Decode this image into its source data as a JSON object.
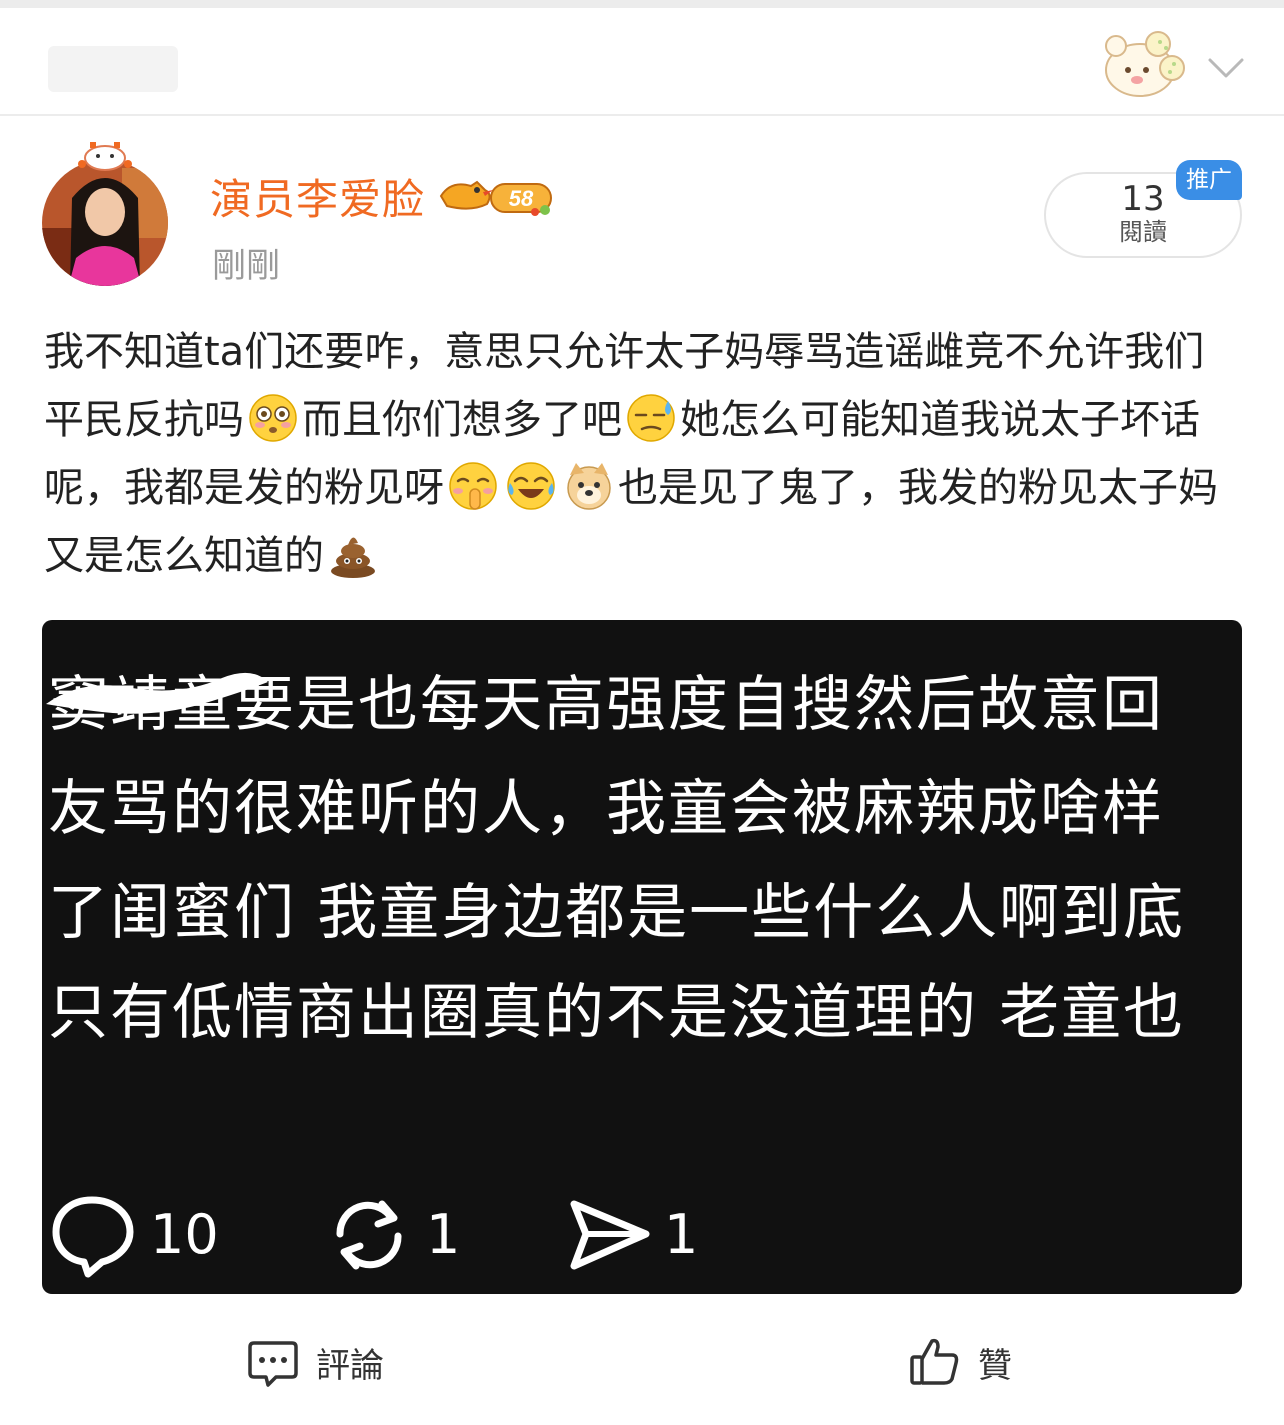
{
  "colors": {
    "username": "#f06a22",
    "promo": "#3a8ee6",
    "screenshot_bg": "#111111"
  },
  "header": {
    "sticker_icon": "bear-sticker-icon",
    "dropdown_icon": "chevron-down-icon"
  },
  "post": {
    "author": "演员李爱脸",
    "level_badge": "58",
    "time": "剛剛",
    "reads_count": "13",
    "reads_label": "閱讀",
    "promo_label": "推广",
    "text_segments": [
      "我不知道ta们还要咋，意思只允许太子妈辱骂造谣雌竞不允许我们平民反抗吗",
      "而且你们想多了吧",
      "她怎么可能知道我说太子坏话呢，我都是发的粉见呀",
      "也是见了鬼了，我发的粉见太子妈又是怎么知道的"
    ],
    "emojis": [
      "flushed-emoji",
      "sweat-emoji",
      "shush-emoji",
      "laughing-tears-emoji",
      "doge-emoji",
      "poop-emoji"
    ]
  },
  "screenshot": {
    "lines": [
      "窦靖童要是也每天高强度自搜然后故意回",
      "友骂的很难听的人，我童会被麻辣成啥样",
      "了闺蜜们 我童身边都是一些什么人啊到底",
      "只有低情商出圈真的不是没道理的 老童也"
    ],
    "comments_count": "10",
    "reposts_count": "1",
    "shares_count": "1"
  },
  "footer": {
    "comment_label": "評論",
    "like_label": "贊"
  }
}
